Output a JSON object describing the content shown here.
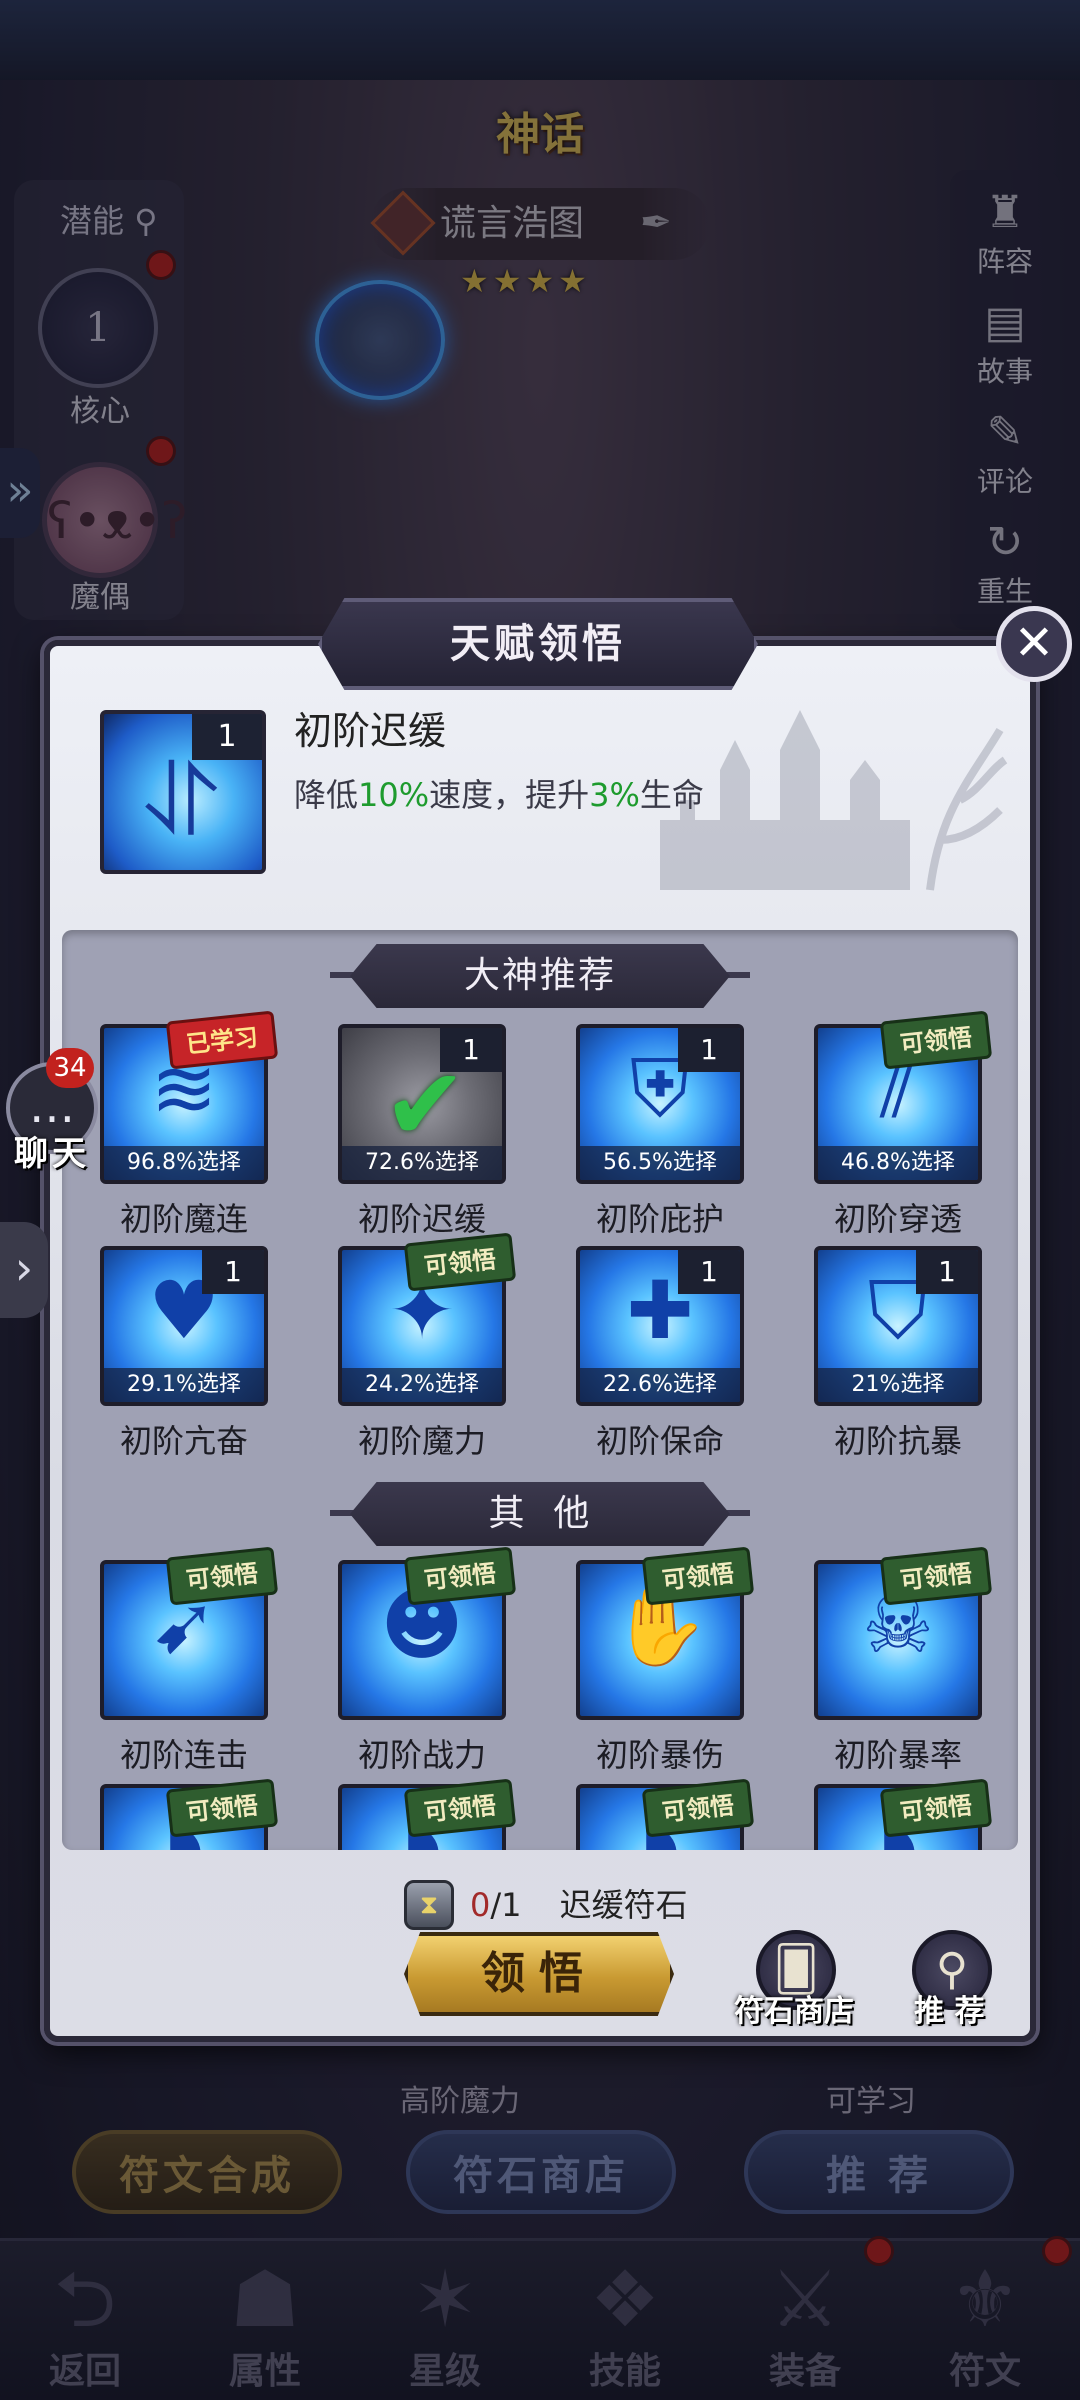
{
  "background": {
    "mode_title": "神话",
    "hero_name": "谎言浩图",
    "star_count": 4,
    "stars": "★★★★",
    "potential_label": "潜能",
    "core_level": "1",
    "core_label": "核心",
    "puppet_label": "魔偶",
    "right_menu": [
      {
        "label": "阵容",
        "icon": "lineup-icon"
      },
      {
        "label": "故事",
        "icon": "book-icon"
      },
      {
        "label": "评论",
        "icon": "quill-icon"
      },
      {
        "label": "重生",
        "icon": "reset-icon"
      }
    ],
    "behind_labels": {
      "high_magic": "高阶魔力",
      "learnable": "可学习"
    },
    "buttons": {
      "synthesis": "符文合成",
      "rune_shop": "符石商店",
      "recommend": "推 荐"
    },
    "tabs": [
      {
        "label": "返回",
        "icon": "back-icon"
      },
      {
        "label": "属性",
        "icon": "hood-icon"
      },
      {
        "label": "星级",
        "icon": "star-icon"
      },
      {
        "label": "技能",
        "icon": "scroll-icon"
      },
      {
        "label": "装备",
        "icon": "swords-icon"
      },
      {
        "label": "符文",
        "icon": "rune-icon"
      }
    ]
  },
  "chat": {
    "badge": "34",
    "label": "聊天"
  },
  "modal": {
    "title": "天赋领悟",
    "selected": {
      "level": "1",
      "name": "初阶迟缓",
      "desc_pre": "降低",
      "desc_val1": "10%",
      "desc_mid": "速度，提升",
      "desc_val2": "3%",
      "desc_post": "生命"
    },
    "recommend_header": "大神推荐",
    "other_header": "其  他",
    "recommended": [
      {
        "name": "初阶魔连",
        "pct": "96.8%选择",
        "tag": "已学习",
        "level": "",
        "glyph": "≋"
      },
      {
        "name": "初阶迟缓",
        "pct": "72.6%选择",
        "tag": "",
        "level": "1",
        "glyph": "✔"
      },
      {
        "name": "初阶庇护",
        "pct": "56.5%选择",
        "tag": "",
        "level": "1",
        "glyph": "⛨"
      },
      {
        "name": "初阶穿透",
        "pct": "46.8%选择",
        "tag": "可领悟",
        "level": "",
        "glyph": "⫽"
      },
      {
        "name": "初阶亢奋",
        "pct": "29.1%选择",
        "tag": "",
        "level": "1",
        "glyph": "♥"
      },
      {
        "name": "初阶魔力",
        "pct": "24.2%选择",
        "tag": "可领悟",
        "level": "",
        "glyph": "✦"
      },
      {
        "name": "初阶保命",
        "pct": "22.6%选择",
        "tag": "",
        "level": "1",
        "glyph": "✚"
      },
      {
        "name": "初阶抗暴",
        "pct": "21%选择",
        "tag": "",
        "level": "1",
        "glyph": "⛉"
      }
    ],
    "others": [
      {
        "name": "初阶连击",
        "tag": "可领悟",
        "glyph": "➹"
      },
      {
        "name": "初阶战力",
        "tag": "可领悟",
        "glyph": "☻"
      },
      {
        "name": "初阶暴伤",
        "tag": "可领悟",
        "glyph": "✋"
      },
      {
        "name": "初阶暴率",
        "tag": "可领悟",
        "glyph": "☠"
      },
      {
        "name": "",
        "tag": "可领悟",
        "glyph": "◗"
      },
      {
        "name": "",
        "tag": "可领悟",
        "glyph": "◗"
      },
      {
        "name": "",
        "tag": "可领悟",
        "glyph": "◗"
      },
      {
        "name": "",
        "tag": "可领悟",
        "glyph": "◗"
      }
    ],
    "cost": {
      "have": "0",
      "need": "/1",
      "item": "迟缓符石"
    },
    "comprehend_label": "领悟",
    "rune_shop_label": "符石商店",
    "recommend_label": "推 荐"
  },
  "colors": {
    "accent_green": "#1e9b2e",
    "gold": "#e7c44c",
    "badge_red": "#c2221e"
  }
}
